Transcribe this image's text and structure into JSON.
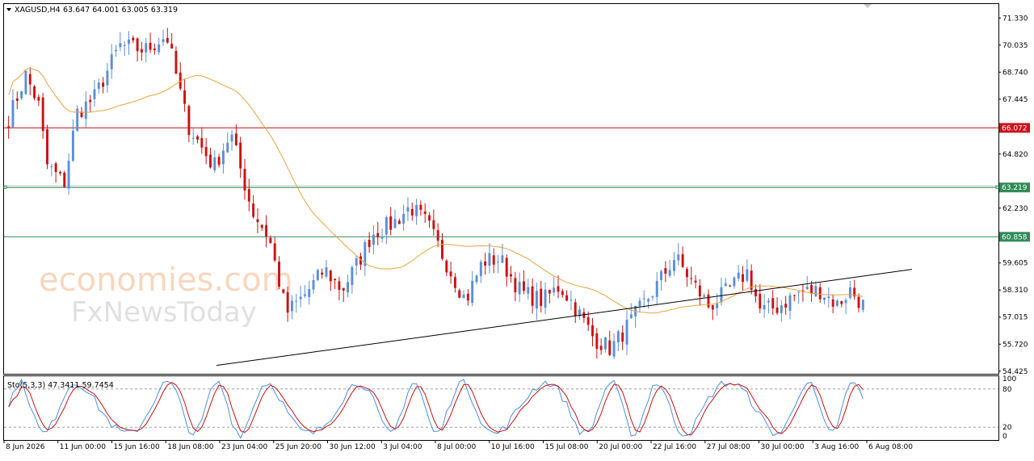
{
  "header": {
    "symbol": "XAGUSD,H4",
    "ohlc": "63.647 64.001 63.005 63.319"
  },
  "watermark": {
    "line1": "economies.com",
    "line2": "FxNewsToday"
  },
  "colors": {
    "bull": "#5b8fd8",
    "bear": "#cc1111",
    "ma": "#e8a33c",
    "resistance": "#d0101a",
    "support": "#2e8b57",
    "trendline": "#000000",
    "stoch_main": "#4a90e2",
    "stoch_signal": "#cc1111"
  },
  "chart_data": {
    "type": "candlestick",
    "symbol": "XAGUSD",
    "timeframe": "H4",
    "ylim": [
      54.3,
      72.0
    ],
    "y_ticks": [
      "71.330",
      "70.035",
      "68.740",
      "67.445",
      "64.820",
      "62.230",
      "59.605",
      "58.310",
      "57.015",
      "55.720",
      "54.425"
    ],
    "x_ticks": [
      "8 Jun 2026",
      "11 Jun 00:00",
      "15 Jun 16:00",
      "18 Jun 08:00",
      "23 Jun 04:00",
      "25 Jun 20:00",
      "30 Jun 12:00",
      "3 Jul 04:00",
      "8 Jul 00:00",
      "10 Jul 16:00",
      "15 Jul 08:00",
      "20 Jul 00:00",
      "22 Jul 16:00",
      "27 Jul 08:00",
      "30 Jul 00:00",
      "3 Aug 16:00",
      "6 Aug 08:00"
    ],
    "horizontal_levels": [
      {
        "label": "66.072",
        "value": 66.072,
        "role": "resistance"
      },
      {
        "label": "63.219",
        "value": 63.219,
        "role": "current"
      },
      {
        "label": "60.858",
        "value": 60.858,
        "role": "support"
      }
    ],
    "trendline": {
      "from": {
        "bar": 0.245,
        "price": 54.7
      },
      "to": {
        "bar": 0.913,
        "price": 59.3
      }
    },
    "price_path": [
      [
        0.0,
        66.5
      ],
      [
        0.02,
        68.6
      ],
      [
        0.035,
        67.2
      ],
      [
        0.045,
        64.3
      ],
      [
        0.065,
        63.4
      ],
      [
        0.08,
        66.8
      ],
      [
        0.1,
        67.5
      ],
      [
        0.13,
        70.0
      ],
      [
        0.16,
        69.8
      ],
      [
        0.185,
        70.5
      ],
      [
        0.21,
        66.2
      ],
      [
        0.24,
        64.2
      ],
      [
        0.26,
        65.8
      ],
      [
        0.285,
        62.1
      ],
      [
        0.305,
        60.8
      ],
      [
        0.325,
        57.2
      ],
      [
        0.345,
        58.0
      ],
      [
        0.37,
        59.3
      ],
      [
        0.39,
        58.3
      ],
      [
        0.41,
        59.7
      ],
      [
        0.425,
        61.0
      ],
      [
        0.45,
        61.5
      ],
      [
        0.47,
        62.3
      ],
      [
        0.49,
        61.5
      ],
      [
        0.51,
        59.8
      ],
      [
        0.535,
        57.8
      ],
      [
        0.555,
        59.7
      ],
      [
        0.575,
        59.8
      ],
      [
        0.6,
        58.2
      ],
      [
        0.625,
        57.8
      ],
      [
        0.645,
        58.5
      ],
      [
        0.66,
        57.7
      ],
      [
        0.685,
        56.0
      ],
      [
        0.705,
        55.5
      ],
      [
        0.73,
        56.9
      ],
      [
        0.755,
        58.3
      ],
      [
        0.78,
        59.9
      ],
      [
        0.8,
        58.7
      ],
      [
        0.82,
        57.5
      ],
      [
        0.845,
        58.4
      ],
      [
        0.865,
        59.2
      ],
      [
        0.88,
        57.3
      ],
      [
        0.9,
        57.5
      ],
      [
        0.925,
        58.2
      ],
      [
        0.95,
        58.3
      ],
      [
        0.97,
        57.6
      ],
      [
        0.985,
        58.3
      ],
      [
        1.0,
        57.6
      ]
    ],
    "price_path_note": "",
    "stochastic": {
      "label": "Sto(5,3,3) 47.3411 59.7454",
      "ylim": [
        0,
        100
      ],
      "levels": [
        "100",
        "80",
        "20",
        "0"
      ]
    }
  }
}
